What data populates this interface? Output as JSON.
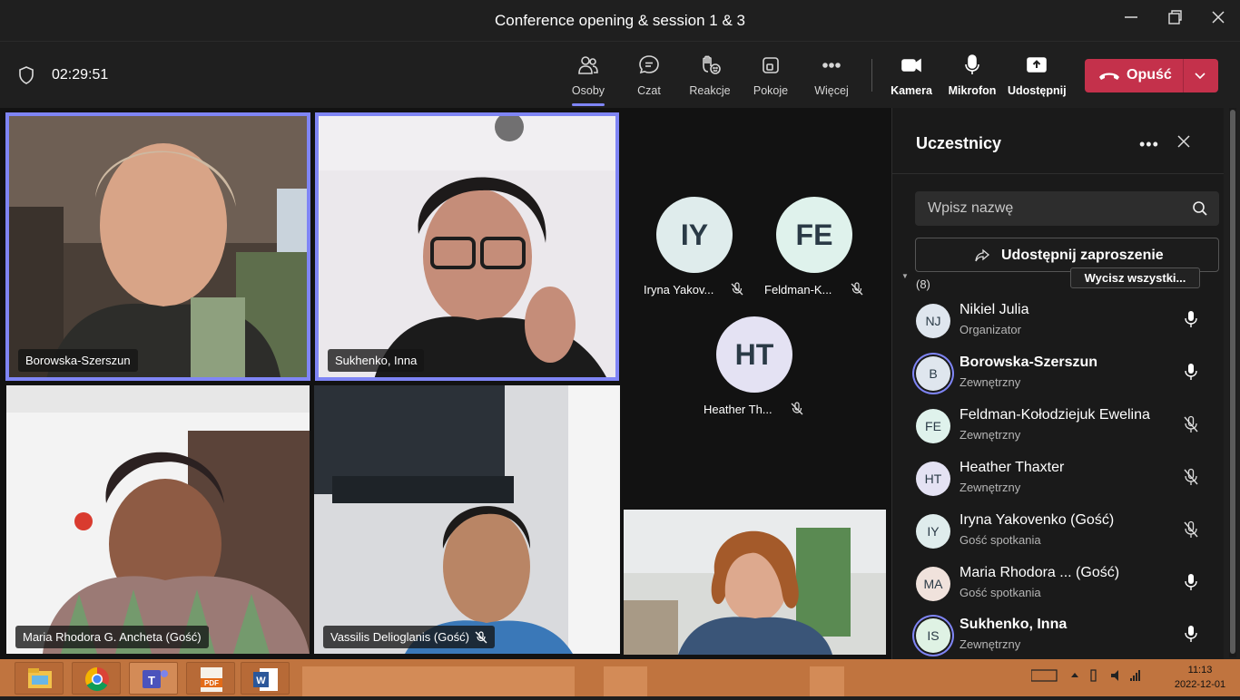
{
  "window": {
    "title": "Conference opening & session 1 & 3",
    "minimize_icon": "minimize-icon",
    "maximize_icon": "maximize-icon",
    "close_icon": "close-icon"
  },
  "toolbar": {
    "timer": "02:29:51",
    "items": [
      {
        "label": "Osoby",
        "icon": "people-icon",
        "active": true
      },
      {
        "label": "Czat",
        "icon": "chat-icon"
      },
      {
        "label": "Reakcje",
        "icon": "raise-hand-icon"
      },
      {
        "label": "Pokoje",
        "icon": "rooms-icon"
      },
      {
        "label": "Więcej",
        "icon": "more-icon"
      },
      {
        "label": "Kamera",
        "icon": "camera-icon"
      },
      {
        "label": "Mikrofon",
        "icon": "microphone-icon"
      },
      {
        "label": "Udostępnij",
        "icon": "share-screen-icon"
      }
    ],
    "leave_label": "Opuść",
    "accent": "#7f85f5",
    "leave_color": "#c4314b"
  },
  "stage": {
    "tiles": [
      {
        "name": "Borowska-Szerszun",
        "speaking": true
      },
      {
        "name": "Sukhenko, Inna",
        "speaking": true
      },
      {
        "name": "Maria Rhodora G. Ancheta (Gość)"
      },
      {
        "name": "Vassilis Delioglanis (Gość)",
        "muted": true
      }
    ],
    "avatars": [
      {
        "initials": "IY",
        "label": "Iryna Yakov...",
        "color": "#dfecec"
      },
      {
        "initials": "FE",
        "label": "Feldman-K...",
        "color": "#dff2ec"
      },
      {
        "initials": "HT",
        "label": "Heather Th...",
        "color": "#e4e2f3"
      }
    ]
  },
  "panel": {
    "title": "Uczestnicy",
    "search_placeholder": "Wpisz nazwę",
    "invite_label": "Udostępnij zaproszenie",
    "section_count": "(8)",
    "mute_all_label": "Wycisz wszystki...",
    "participants": [
      {
        "initials": "NJ",
        "name": "Nikiel Julia",
        "role": "Organizator",
        "muted": false,
        "color": "#dfe6ee"
      },
      {
        "initials": "B",
        "name": "Borowska-Szerszun",
        "role": "Zewnętrzny",
        "muted": false,
        "bold": true,
        "ring": true,
        "color": "#dfe6ee"
      },
      {
        "initials": "FE",
        "name": "Feldman-Kołodziejuk Ewelina",
        "role": "Zewnętrzny",
        "muted": true,
        "color": "#dff2ec"
      },
      {
        "initials": "HT",
        "name": "Heather Thaxter",
        "role": "Zewnętrzny",
        "muted": true,
        "color": "#e4e2f3"
      },
      {
        "initials": "IY",
        "name": "Iryna Yakovenko (Gość)",
        "role": "Gość spotkania",
        "muted": true,
        "color": "#dfecec"
      },
      {
        "initials": "MA",
        "name": "Maria Rhodora ...   (Gość)",
        "role": "Gość spotkania",
        "muted": false,
        "color": "#f0e2dc"
      },
      {
        "initials": "IS",
        "name": "Sukhenko, Inna",
        "role": "Zewnętrzny",
        "muted": false,
        "bold": true,
        "ring": true,
        "color": "#dff2e4"
      }
    ]
  },
  "taskbar": {
    "apps": [
      "file-explorer-icon",
      "chrome-icon",
      "teams-icon",
      "pdf-icon",
      "word-icon"
    ],
    "time": "11:13",
    "date": "2022-12-01"
  }
}
